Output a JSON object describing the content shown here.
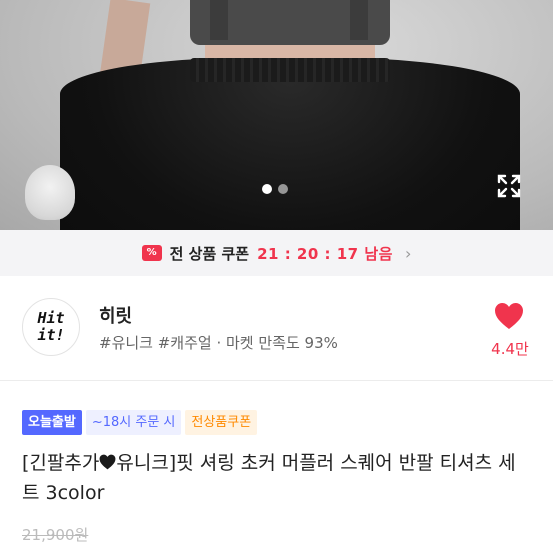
{
  "photo": {
    "carousel_count": 2,
    "carousel_active_index": 0,
    "expand_icon": "expand-icon"
  },
  "coupon_bar": {
    "icon": "coupon-ticket-icon",
    "ticket_symbol": "%",
    "label": "전 상품 쿠폰",
    "timer": "21 : 20 : 17 남음",
    "chevron": "›"
  },
  "shop": {
    "logo_line1": "Hit",
    "logo_line2": "it!",
    "name": "히릿",
    "tags": "#유니크 #캐주얼 · 마켓 만족도 93%",
    "like_icon": "heart-icon",
    "like_count": "4.4만",
    "accent": "#f0344d"
  },
  "badges": {
    "today": "오늘출발",
    "order": "~18시 주문 시",
    "coupon": "전상품쿠폰"
  },
  "product": {
    "title_part1": "[긴팔추가",
    "title_part2": "유니크]핏 셔링 초커 머플러 스퀘어 반팔 티셔츠 세트 3color",
    "original_price": "21,900원"
  }
}
